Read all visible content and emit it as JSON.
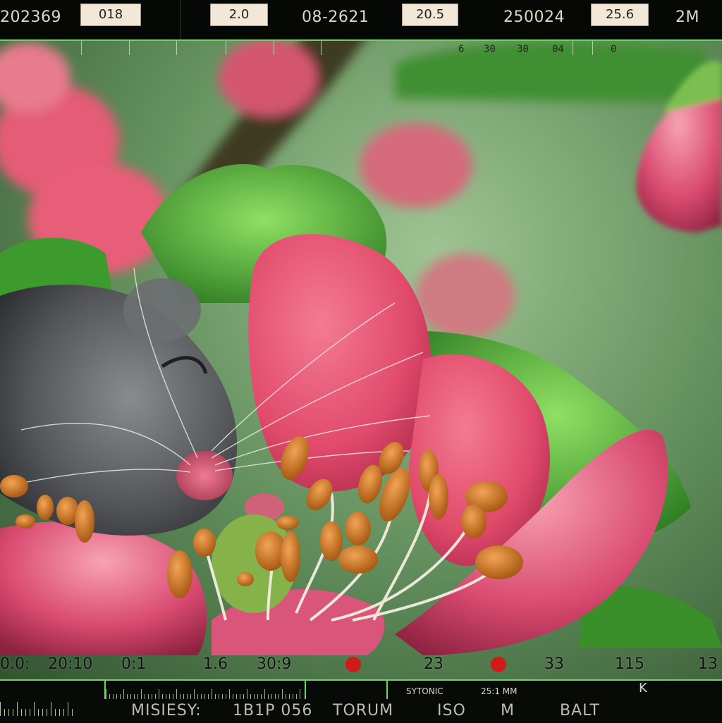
{
  "top_bar": {
    "fields": [
      {
        "label": "202369"
      },
      {
        "box": "018"
      },
      {
        "box": "2.0"
      },
      {
        "label": "08-2621"
      },
      {
        "box": "20.5"
      },
      {
        "label": "250024"
      },
      {
        "box": "25.6"
      },
      {
        "label": "2M"
      }
    ]
  },
  "top_scale": {
    "numbers": [
      "6",
      "30",
      "30",
      "04",
      "0"
    ]
  },
  "readout_row": {
    "values": [
      "0.0:",
      "20:10",
      "0:1",
      "1.6",
      "30:9",
      "23",
      "33",
      "115",
      "13"
    ]
  },
  "bottom_bar": {
    "labels": [
      "MISIESY:",
      "1B1P 056",
      "TORUM",
      "ISO",
      "M",
      "BALT"
    ],
    "small_labels": [
      "SYTONIC",
      "25:1 MM"
    ],
    "mark": "K"
  },
  "scene": {
    "subject": "sleeping mouse nestled inside a pink flower",
    "colors": {
      "background_green": "#5f8c5a",
      "petal_pink": "#e14a6b",
      "leaf_green": "#3f9a2e",
      "stamen_orange": "#c8741f",
      "mouse_gray": "#5c5d60",
      "accent_green": "#6fd36a",
      "record_red": "#d11a1a"
    }
  }
}
